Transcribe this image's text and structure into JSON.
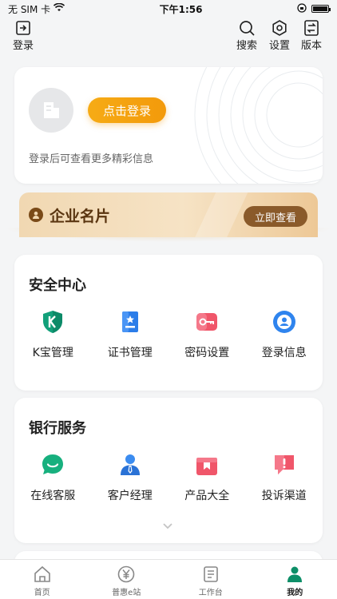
{
  "status_bar": {
    "carrier": "无 SIM 卡",
    "time": "下午1:56"
  },
  "topbar": {
    "login_label": "登录",
    "search_label": "搜索",
    "settings_label": "设置",
    "version_label": "版本"
  },
  "login_card": {
    "button_label": "点击登录",
    "hint": "登录后可查看更多精彩信息"
  },
  "business_card": {
    "title": "企业名片",
    "button_label": "立即查看"
  },
  "security_center": {
    "title": "安全中心",
    "items": [
      {
        "label": "K宝管理",
        "icon": "k-shield-icon"
      },
      {
        "label": "证书管理",
        "icon": "certificate-icon"
      },
      {
        "label": "密码设置",
        "icon": "key-icon"
      },
      {
        "label": "登录信息",
        "icon": "login-info-icon"
      }
    ]
  },
  "bank_services": {
    "title": "银行服务",
    "items": [
      {
        "label": "在线客服",
        "icon": "chat-icon"
      },
      {
        "label": "客户经理",
        "icon": "manager-icon"
      },
      {
        "label": "产品大全",
        "icon": "product-icon"
      },
      {
        "label": "投诉渠道",
        "icon": "complaint-icon"
      }
    ]
  },
  "tabbar": {
    "tabs": [
      {
        "label": "首页",
        "icon": "home-icon"
      },
      {
        "label": "普惠e站",
        "icon": "yuan-icon"
      },
      {
        "label": "工作台",
        "icon": "workbench-icon"
      },
      {
        "label": "我的",
        "icon": "person-icon",
        "active": true
      }
    ]
  },
  "colors": {
    "accent": "#f6a512",
    "brand": "#0d8f68",
    "card_gold": "#8a5a2a"
  }
}
